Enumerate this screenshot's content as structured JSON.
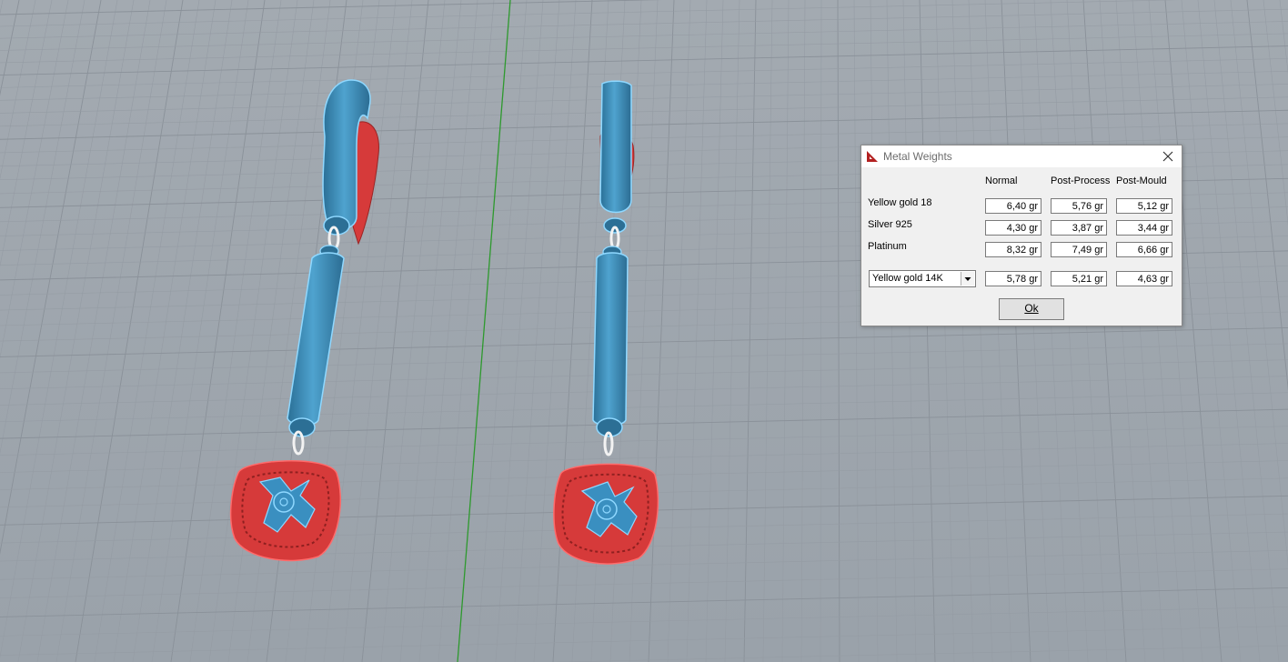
{
  "dialog": {
    "title": "Metal Weights",
    "columns": [
      "Normal",
      "Post-Process",
      "Post-Mould"
    ],
    "rows": [
      {
        "label": "Yellow gold 18",
        "values": [
          "6,40 gr",
          "5,76 gr",
          "5,12 gr"
        ]
      },
      {
        "label": "Silver 925",
        "values": [
          "4,30 gr",
          "3,87 gr",
          "3,44 gr"
        ]
      },
      {
        "label": "Platinum",
        "values": [
          "8,32 gr",
          "7,49 gr",
          "6,66 gr"
        ]
      }
    ],
    "custom": {
      "selected": "Yellow gold 14K",
      "values": [
        "5,78 gr",
        "5,21 gr",
        "4,63 gr"
      ]
    },
    "ok_label": "Ok"
  },
  "colors": {
    "viewport_bg": "#9ea6ae",
    "selection_blue": "#3a8fc0",
    "red_highlight": "#d63a3a",
    "axis_green": "#2e9a2e"
  },
  "icons": {
    "dialog": "ruler-triangle-icon",
    "close": "close-icon",
    "dropdown": "chevron-down-icon"
  }
}
